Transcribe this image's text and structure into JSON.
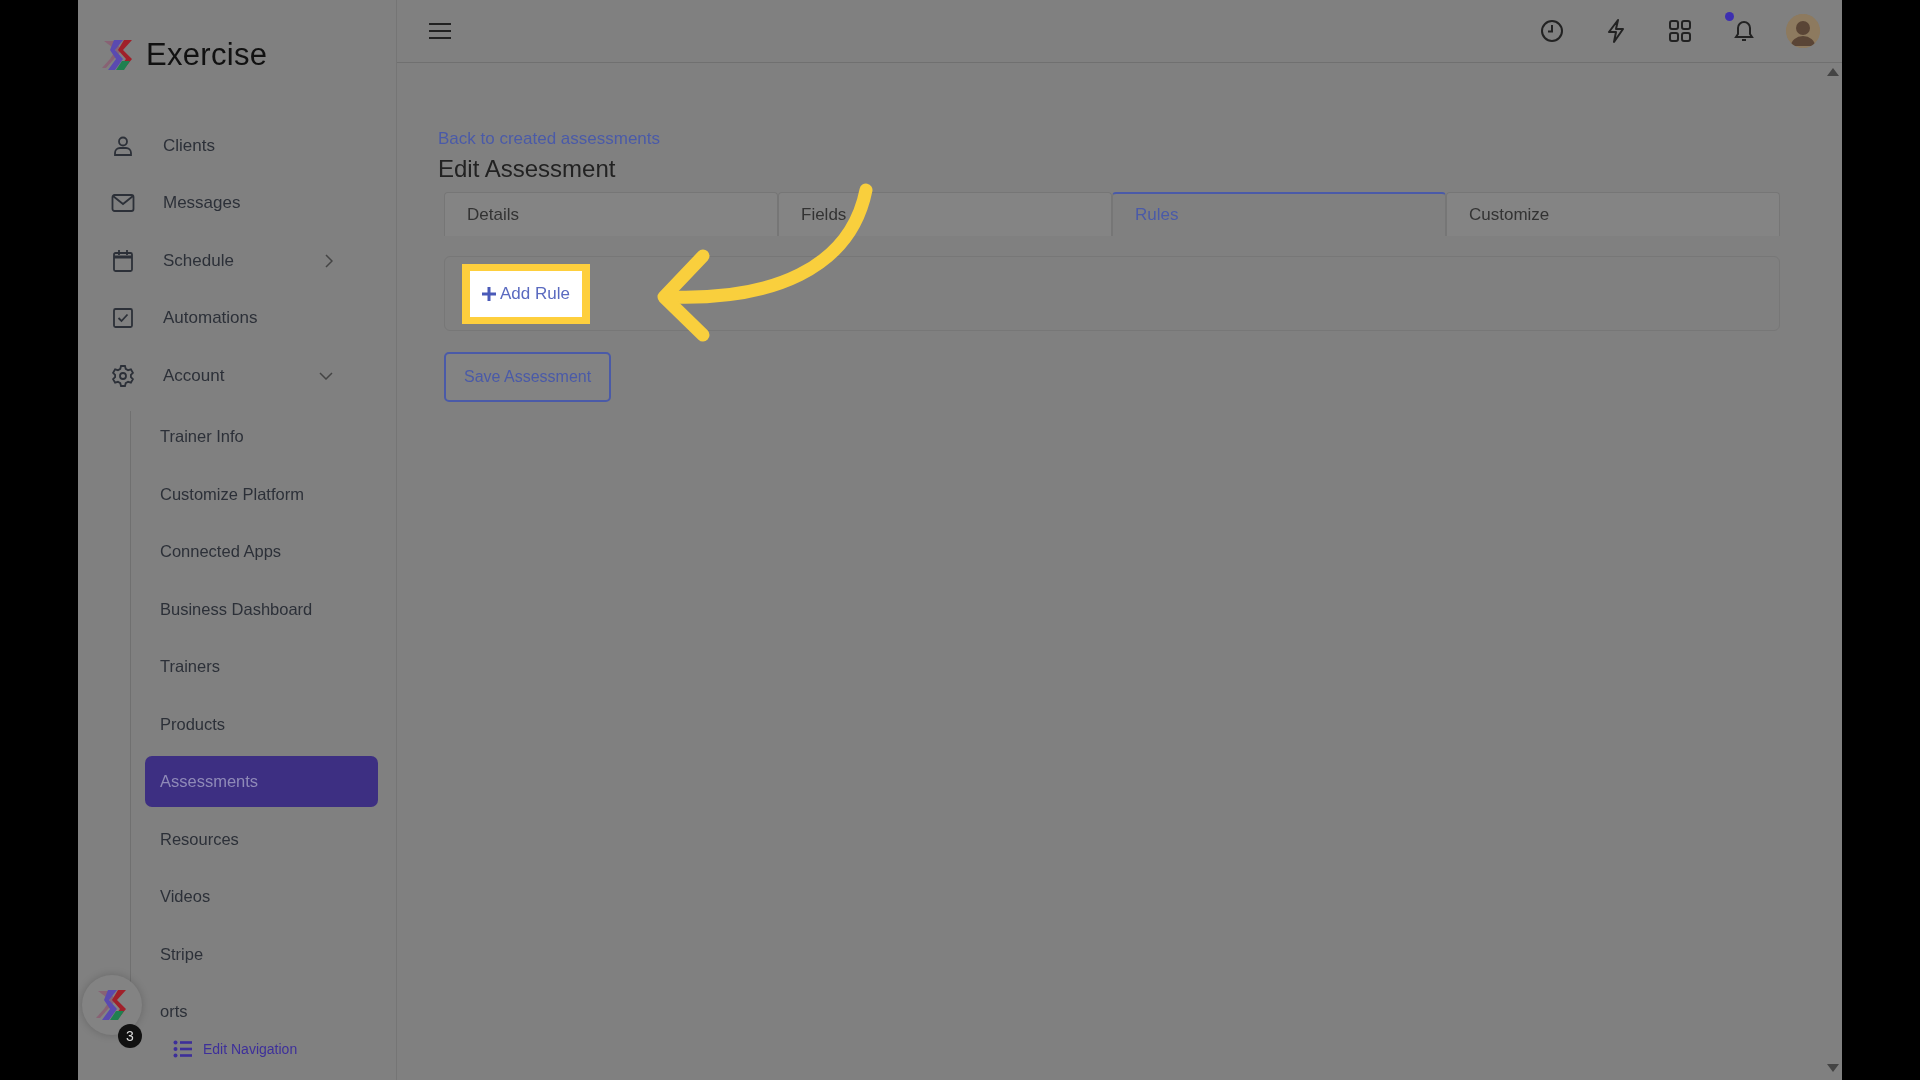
{
  "app": {
    "name": "Exercise"
  },
  "sidebar": {
    "items": [
      {
        "kind": "person",
        "label": "Clients"
      },
      {
        "kind": "mail",
        "label": "Messages"
      },
      {
        "kind": "calendar",
        "label": "Schedule",
        "expanded": false
      },
      {
        "kind": "checkbox",
        "label": "Automations"
      },
      {
        "kind": "gear",
        "label": "Account",
        "expanded": true,
        "children": [
          {
            "label": "Trainer Info",
            "selected": false
          },
          {
            "label": "Customize Platform",
            "selected": false
          },
          {
            "label": "Connected Apps",
            "selected": false
          },
          {
            "label": "Business Dashboard",
            "selected": false
          },
          {
            "label": "Trainers",
            "selected": false
          },
          {
            "label": "Products",
            "selected": false
          },
          {
            "label": "Assessments",
            "selected": true
          },
          {
            "label": "Resources",
            "selected": false
          },
          {
            "label": "Videos",
            "selected": false
          },
          {
            "label": "Stripe",
            "selected": false
          },
          {
            "label": "orts",
            "selected": false
          }
        ]
      }
    ],
    "edit_link": "Edit Navigation",
    "helper_badge": "3"
  },
  "topbar": {
    "notifications_unread": true
  },
  "page": {
    "back_link": "Back to created assessments",
    "title": "Edit Assessment",
    "tabs": [
      {
        "label": "Details",
        "selected": false
      },
      {
        "label": "Fields",
        "selected": false
      },
      {
        "label": "Rules",
        "selected": true
      },
      {
        "label": "Customize",
        "selected": false
      }
    ],
    "add_button": {
      "label": "Add Rule",
      "highlighted": true
    },
    "save_button": "Save Assessment",
    "callout_arrow": true
  }
}
